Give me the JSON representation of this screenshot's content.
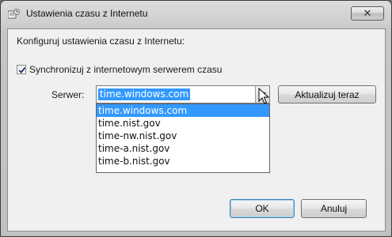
{
  "window": {
    "title": "Ustawienia czasu z Internetu",
    "close_label": "✕"
  },
  "main": {
    "intro_text": "Konfiguruj ustawienia czasu z Internetu:",
    "sync_checkbox": {
      "label": "Synchronizuj z internetowym serwerem czasu",
      "checked": true
    },
    "server": {
      "label": "Serwer:",
      "value": "time.windows.com",
      "options": [
        "time.windows.com",
        "time.nist.gov",
        "time-nw.nist.gov",
        "time-a.nist.gov",
        "time-b.nist.gov"
      ],
      "selected_index": 0
    },
    "update_button": "Aktualizuj teraz"
  },
  "footer": {
    "ok_label": "OK",
    "cancel_label": "Anuluj"
  },
  "colors": {
    "selection": "#3399ff",
    "client_background": "#f0f0f0"
  },
  "icons": {
    "title": "clock-globe-icon",
    "dropdown": "chevron-down-icon",
    "cursor": "mouse-pointer-icon",
    "checkbox": "checkmark-icon"
  }
}
